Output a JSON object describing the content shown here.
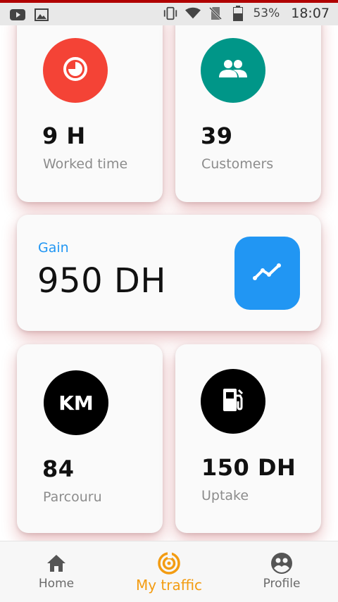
{
  "status_bar": {
    "battery": "53%",
    "time": "18:07",
    "icons": [
      "youtube-icon",
      "image-icon",
      "vibrate-icon",
      "wifi-icon",
      "no-sim-icon",
      "battery-icon"
    ]
  },
  "cards": {
    "worked_time": {
      "value": "9 H",
      "label": "Worked time",
      "icon": "clock-icon",
      "color": "#f44336"
    },
    "customers": {
      "value": "39",
      "label": "Customers",
      "icon": "people-icon",
      "color": "#009688"
    },
    "gain": {
      "label": "Gain",
      "value": "950 DH",
      "icon": "trending-up-icon",
      "color": "#2196f3"
    },
    "parcouru": {
      "value": "84",
      "label": "Parcouru",
      "badge": "KM",
      "color": "#000000"
    },
    "uptake": {
      "value": "150 DH",
      "label": "Uptake",
      "icon": "fuel-pump-icon",
      "color": "#000000"
    }
  },
  "bottom_nav": {
    "items": [
      {
        "label": "Home",
        "icon": "home-icon"
      },
      {
        "label": "My traffic",
        "icon": "traffic-icon",
        "active": true
      },
      {
        "label": "Profile",
        "icon": "profile-icon"
      }
    ],
    "accent": "#f39c12"
  }
}
